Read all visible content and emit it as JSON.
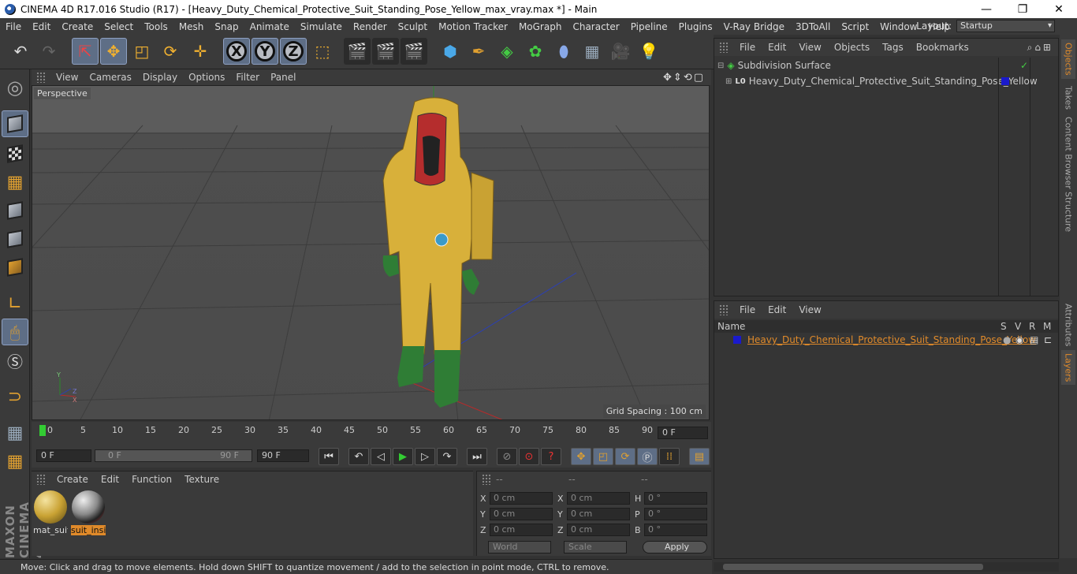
{
  "titlebar": {
    "title": "CINEMA 4D R17.016 Studio (R17) - [Heavy_Duty_Chemical_Protective_Suit_Standing_Pose_Yellow_max_vray.max *] - Main"
  },
  "menubar": {
    "items": [
      "File",
      "Edit",
      "Create",
      "Select",
      "Tools",
      "Mesh",
      "Snap",
      "Animate",
      "Simulate",
      "Render",
      "Sculpt",
      "Motion Tracker",
      "MoGraph",
      "Character",
      "Pipeline",
      "Plugins",
      "V-Ray Bridge",
      "3DToAll",
      "Script",
      "Window",
      "Help"
    ],
    "layout_label": "Layout:",
    "layout_value": "Startup"
  },
  "viewport": {
    "menu": [
      "View",
      "Cameras",
      "Display",
      "Options",
      "Filter",
      "Panel"
    ],
    "label": "Perspective",
    "grid_spacing": "Grid Spacing : 100 cm"
  },
  "timeline": {
    "ticks": [
      "0",
      "5",
      "10",
      "15",
      "20",
      "25",
      "30",
      "35",
      "40",
      "45",
      "50",
      "55",
      "60",
      "65",
      "70",
      "75",
      "80",
      "85",
      "90"
    ],
    "current": "0 F"
  },
  "transport": {
    "start": "0 F",
    "range_start": "0 F",
    "range_end": "90 F",
    "end": "90 F"
  },
  "materials": {
    "menu": [
      "Create",
      "Edit",
      "Function",
      "Texture"
    ],
    "items": [
      {
        "name": "mat_suit"
      },
      {
        "name": "suit_insi"
      }
    ]
  },
  "coords": {
    "headers": [
      "--",
      "--",
      "--"
    ],
    "rows": [
      [
        "X",
        "0 cm",
        "X",
        "0 cm",
        "H",
        "0 °"
      ],
      [
        "Y",
        "0 cm",
        "Y",
        "0 cm",
        "P",
        "0 °"
      ],
      [
        "Z",
        "0 cm",
        "Z",
        "0 cm",
        "B",
        "0 °"
      ]
    ],
    "world": "World",
    "scale": "Scale",
    "apply": "Apply"
  },
  "status": {
    "text": "Move: Click and drag to move elements. Hold down SHIFT to quantize movement / add to the selection in point mode, CTRL to remove."
  },
  "objects": {
    "menu": [
      "File",
      "Edit",
      "View",
      "Objects",
      "Tags",
      "Bookmarks"
    ],
    "items": [
      "Subdivision Surface",
      "Heavy_Duty_Chemical_Protective_Suit_Standing_Pose_Yellow"
    ]
  },
  "layers": {
    "menu": [
      "File",
      "Edit",
      "View"
    ],
    "columns": [
      "Name",
      "S",
      "V",
      "R",
      "M"
    ],
    "item": "Heavy_Duty_Chemical_Protective_Suit_Standing_Pose_Yellow"
  },
  "right_tabs": [
    "Objects",
    "Takes",
    "Content Browser",
    "Structure",
    "Attributes",
    "Layers"
  ],
  "colors": {
    "accent": "#e08a2a",
    "selection": "#5e6e86",
    "suit": "#d8b03a",
    "boots": "#3f8a3f"
  }
}
